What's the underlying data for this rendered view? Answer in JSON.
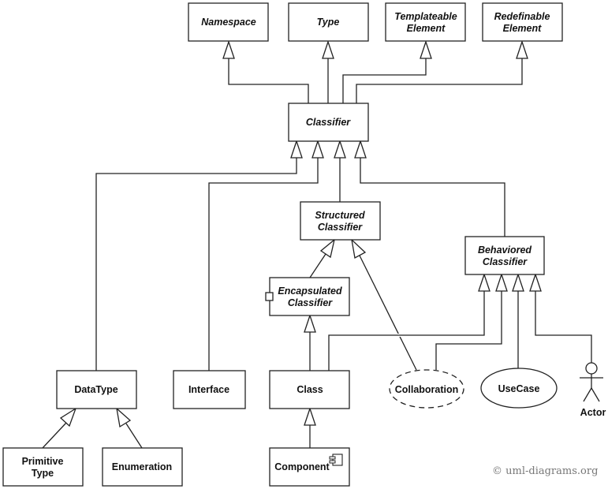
{
  "diagram": {
    "type": "UML class diagram",
    "copyright": "© uml-diagrams.org",
    "classes": {
      "namespace": {
        "lines": [
          "Namespace"
        ],
        "abstract": true
      },
      "type": {
        "lines": [
          "Type"
        ],
        "abstract": true
      },
      "templateable_element": {
        "lines": [
          "Templateable",
          "Element"
        ],
        "abstract": true
      },
      "redefinable_element": {
        "lines": [
          "Redefinable",
          "Element"
        ],
        "abstract": true
      },
      "classifier": {
        "lines": [
          "Classifier"
        ],
        "abstract": true
      },
      "structured_classifier": {
        "lines": [
          "Structured",
          "Classifier"
        ],
        "abstract": true
      },
      "behaviored_classifier": {
        "lines": [
          "Behaviored",
          "Classifier"
        ],
        "abstract": true
      },
      "encapsulated_classifier": {
        "lines": [
          "Encapsulated",
          "Classifier"
        ],
        "abstract": true
      },
      "datatype": {
        "lines": [
          "DataType"
        ],
        "abstract": false
      },
      "interface": {
        "lines": [
          "Interface"
        ],
        "abstract": false
      },
      "class": {
        "lines": [
          "Class"
        ],
        "abstract": false
      },
      "collaboration": {
        "lines": [
          "Collaboration"
        ],
        "abstract": false
      },
      "usecase": {
        "lines": [
          "UseCase"
        ],
        "abstract": false
      },
      "actor": {
        "lines": [
          "Actor"
        ],
        "abstract": false
      },
      "primitive_type": {
        "lines": [
          "Primitive",
          "Type"
        ],
        "abstract": false
      },
      "enumeration": {
        "lines": [
          "Enumeration"
        ],
        "abstract": false
      },
      "component": {
        "lines": [
          "Component"
        ],
        "abstract": false
      }
    },
    "generalizations": [
      {
        "child": "Classifier",
        "parent": "Namespace"
      },
      {
        "child": "Classifier",
        "parent": "Type"
      },
      {
        "child": "Classifier",
        "parent": "Templateable Element"
      },
      {
        "child": "Classifier",
        "parent": "Redefinable Element"
      },
      {
        "child": "DataType",
        "parent": "Classifier"
      },
      {
        "child": "Interface",
        "parent": "Classifier"
      },
      {
        "child": "Structured Classifier",
        "parent": "Classifier"
      },
      {
        "child": "Behaviored Classifier",
        "parent": "Classifier"
      },
      {
        "child": "Encapsulated Classifier",
        "parent": "Structured Classifier"
      },
      {
        "child": "Collaboration",
        "parent": "Structured Classifier"
      },
      {
        "child": "Class",
        "parent": "Encapsulated Classifier"
      },
      {
        "child": "Class",
        "parent": "Behaviored Classifier"
      },
      {
        "child": "Collaboration",
        "parent": "Behaviored Classifier"
      },
      {
        "child": "UseCase",
        "parent": "Behaviored Classifier"
      },
      {
        "child": "Actor",
        "parent": "Behaviored Classifier"
      },
      {
        "child": "Primitive Type",
        "parent": "DataType"
      },
      {
        "child": "Enumeration",
        "parent": "DataType"
      },
      {
        "child": "Component",
        "parent": "Class"
      }
    ]
  }
}
